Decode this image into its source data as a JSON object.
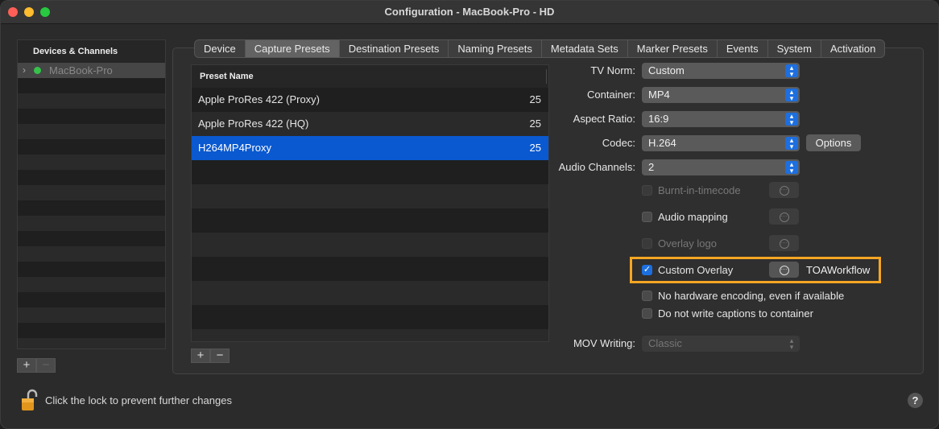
{
  "window": {
    "title": "Configuration - MacBook-Pro - HD"
  },
  "devices": {
    "header": "Devices & Channels",
    "items": [
      {
        "label": "MacBook-Pro",
        "status_color": "#36c14a"
      }
    ],
    "add": "+",
    "remove": "−"
  },
  "tabs": [
    "Device",
    "Capture Presets",
    "Destination Presets",
    "Naming Presets",
    "Metadata Sets",
    "Marker Presets",
    "Events",
    "System",
    "Activation"
  ],
  "active_tab": "Capture Presets",
  "presets": {
    "header": "Preset Name",
    "rows": [
      {
        "name": "Apple ProRes 422 (Proxy)",
        "fps": "25"
      },
      {
        "name": "Apple ProRes 422 (HQ)",
        "fps": "25"
      },
      {
        "name": "H264MP4Proxy",
        "fps": "25",
        "selected": true
      }
    ],
    "add": "+",
    "remove": "−"
  },
  "form": {
    "tv_norm": {
      "label": "TV Norm:",
      "value": "Custom"
    },
    "container": {
      "label": "Container:",
      "value": "MP4"
    },
    "aspect_ratio": {
      "label": "Aspect Ratio:",
      "value": "16:9"
    },
    "codec": {
      "label": "Codec:",
      "value": "H.264",
      "options_button": "Options"
    },
    "audio_channels": {
      "label": "Audio Channels:",
      "value": "2"
    },
    "burnt_in": {
      "label": "Burnt-in-timecode",
      "checked": false,
      "enabled": false
    },
    "audio_mapping": {
      "label": "Audio mapping",
      "checked": false,
      "enabled": true
    },
    "overlay_logo": {
      "label": "Overlay logo",
      "checked": false,
      "enabled": false
    },
    "custom_overlay": {
      "label": "Custom Overlay",
      "checked": true,
      "enabled": true,
      "workflow": "TOAWorkflow",
      "highlight_color": "#f5a623"
    },
    "no_hw_encoding": {
      "label": "No hardware encoding, even if available",
      "checked": false
    },
    "no_captions": {
      "label": "Do not write captions to container",
      "checked": false
    },
    "mov_writing": {
      "label": "MOV Writing:",
      "value": "Classic",
      "enabled": false
    }
  },
  "footer": {
    "lock_text": "Click the lock to prevent further changes",
    "help": "?"
  },
  "colors": {
    "accent": "#1d6fe0",
    "selection": "#0a59d0"
  },
  "icons": {
    "lock": "lock-open-icon",
    "help": "help-icon",
    "ellipsis": "ellipsis-icon"
  }
}
